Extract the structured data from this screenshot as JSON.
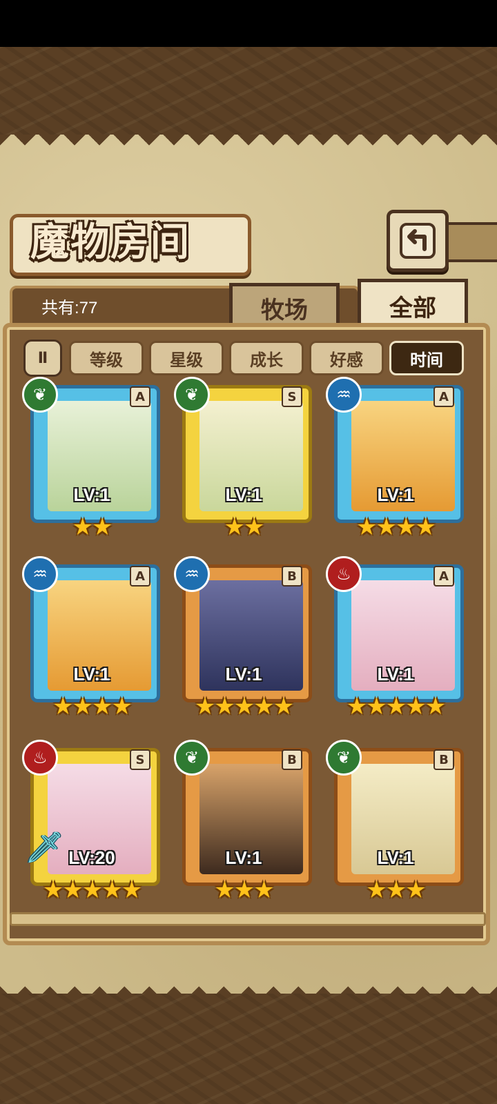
{
  "title": "魔物房间",
  "count_label": "共有:77",
  "tabs": [
    {
      "label": "牧场"
    },
    {
      "label": "全部"
    }
  ],
  "sort": {
    "toggle": "Ⅱ",
    "buttons": [
      {
        "label": "等级"
      },
      {
        "label": "星级"
      },
      {
        "label": "成长"
      },
      {
        "label": "好感"
      },
      {
        "label": "时间"
      }
    ],
    "active_index": 4
  },
  "cards": [
    {
      "element": "leaf",
      "rank": "A",
      "frame": "blue",
      "level": "LV:1",
      "stars": "★★"
    },
    {
      "element": "leaf",
      "rank": "S",
      "frame": "gold",
      "level": "LV:1",
      "stars": "★★"
    },
    {
      "element": "water",
      "rank": "A",
      "frame": "blue",
      "level": "LV:1",
      "stars": "★★★★"
    },
    {
      "element": "water",
      "rank": "A",
      "frame": "blue",
      "level": "LV:1",
      "stars": "★★★★"
    },
    {
      "element": "water",
      "rank": "B",
      "frame": "orange",
      "level": "LV:1",
      "stars": "★★★★★"
    },
    {
      "element": "fire",
      "rank": "A",
      "frame": "blue",
      "level": "LV:1",
      "stars": "★★★★★"
    },
    {
      "element": "fire",
      "rank": "S",
      "frame": "gold",
      "level": "LV:20",
      "stars": "★★★★★"
    },
    {
      "element": "leaf",
      "rank": "B",
      "frame": "orange",
      "level": "LV:1",
      "stars": "★★★"
    },
    {
      "element": "leaf",
      "rank": "B",
      "frame": "orange",
      "level": "LV:1",
      "stars": "★★★"
    }
  ],
  "icons": {
    "leaf": "leaf-icon",
    "water": "water-icon",
    "fire": "fire-icon",
    "back": "back-arrow-icon",
    "sword": "sword-icon"
  },
  "colors": {
    "paper": "#cdbb8a",
    "wood": "#7b5935",
    "leaf": "#2f7a32",
    "water": "#1f6fb0",
    "fire": "#b01e1e",
    "star": "#ffc21a"
  }
}
